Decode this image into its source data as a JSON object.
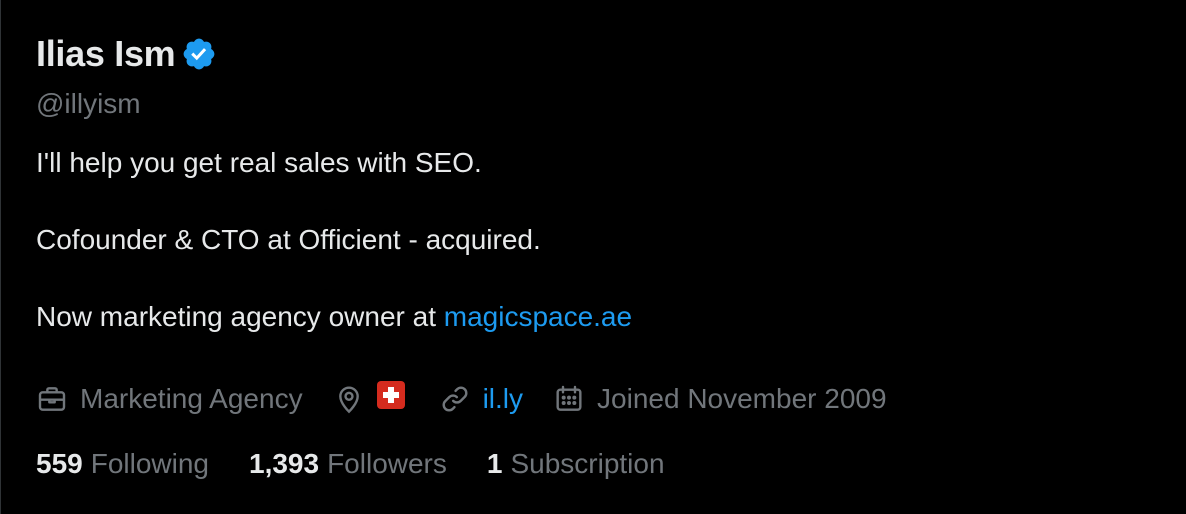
{
  "profile": {
    "display_name": "Ilias Ism",
    "handle": "@illyism",
    "verified": true,
    "bio_lines": [
      "I'll help you get real sales with SEO.",
      "Cofounder & CTO at Officient - acquired.",
      "Now marketing agency owner at "
    ],
    "bio_link": "magicspace.ae"
  },
  "meta": {
    "category": "Marketing Agency",
    "location_icon": "location-pin-icon",
    "location_flag": "swiss-flag",
    "website": "il.ly",
    "joined": "Joined November 2009"
  },
  "stats": {
    "following_count": "559",
    "following_label": "Following",
    "followers_count": "1,393",
    "followers_label": "Followers",
    "subscriptions_count": "1",
    "subscriptions_label": "Subscription"
  },
  "colors": {
    "background": "#000000",
    "text_primary": "#e7e9ea",
    "text_secondary": "#71767b",
    "link": "#1d9bf0",
    "verified_badge": "#1d9bf0",
    "flag_red": "#d52b1e"
  }
}
